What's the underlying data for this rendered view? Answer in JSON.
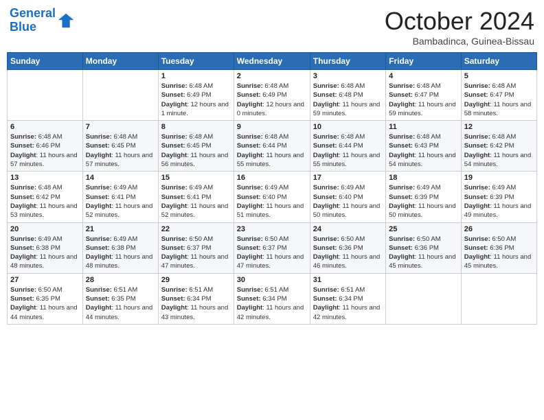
{
  "header": {
    "logo_line1": "General",
    "logo_line2": "Blue",
    "month_title": "October 2024",
    "location": "Bambadinca, Guinea-Bissau"
  },
  "days_of_week": [
    "Sunday",
    "Monday",
    "Tuesday",
    "Wednesday",
    "Thursday",
    "Friday",
    "Saturday"
  ],
  "weeks": [
    [
      {
        "day": "",
        "info": ""
      },
      {
        "day": "",
        "info": ""
      },
      {
        "day": "1",
        "info": "Sunrise: 6:48 AM\nSunset: 6:49 PM\nDaylight: 12 hours and 1 minute."
      },
      {
        "day": "2",
        "info": "Sunrise: 6:48 AM\nSunset: 6:49 PM\nDaylight: 12 hours and 0 minutes."
      },
      {
        "day": "3",
        "info": "Sunrise: 6:48 AM\nSunset: 6:48 PM\nDaylight: 11 hours and 59 minutes."
      },
      {
        "day": "4",
        "info": "Sunrise: 6:48 AM\nSunset: 6:47 PM\nDaylight: 11 hours and 59 minutes."
      },
      {
        "day": "5",
        "info": "Sunrise: 6:48 AM\nSunset: 6:47 PM\nDaylight: 11 hours and 58 minutes."
      }
    ],
    [
      {
        "day": "6",
        "info": "Sunrise: 6:48 AM\nSunset: 6:46 PM\nDaylight: 11 hours and 57 minutes."
      },
      {
        "day": "7",
        "info": "Sunrise: 6:48 AM\nSunset: 6:45 PM\nDaylight: 11 hours and 57 minutes."
      },
      {
        "day": "8",
        "info": "Sunrise: 6:48 AM\nSunset: 6:45 PM\nDaylight: 11 hours and 56 minutes."
      },
      {
        "day": "9",
        "info": "Sunrise: 6:48 AM\nSunset: 6:44 PM\nDaylight: 11 hours and 55 minutes."
      },
      {
        "day": "10",
        "info": "Sunrise: 6:48 AM\nSunset: 6:44 PM\nDaylight: 11 hours and 55 minutes."
      },
      {
        "day": "11",
        "info": "Sunrise: 6:48 AM\nSunset: 6:43 PM\nDaylight: 11 hours and 54 minutes."
      },
      {
        "day": "12",
        "info": "Sunrise: 6:48 AM\nSunset: 6:42 PM\nDaylight: 11 hours and 54 minutes."
      }
    ],
    [
      {
        "day": "13",
        "info": "Sunrise: 6:48 AM\nSunset: 6:42 PM\nDaylight: 11 hours and 53 minutes."
      },
      {
        "day": "14",
        "info": "Sunrise: 6:49 AM\nSunset: 6:41 PM\nDaylight: 11 hours and 52 minutes."
      },
      {
        "day": "15",
        "info": "Sunrise: 6:49 AM\nSunset: 6:41 PM\nDaylight: 11 hours and 52 minutes."
      },
      {
        "day": "16",
        "info": "Sunrise: 6:49 AM\nSunset: 6:40 PM\nDaylight: 11 hours and 51 minutes."
      },
      {
        "day": "17",
        "info": "Sunrise: 6:49 AM\nSunset: 6:40 PM\nDaylight: 11 hours and 50 minutes."
      },
      {
        "day": "18",
        "info": "Sunrise: 6:49 AM\nSunset: 6:39 PM\nDaylight: 11 hours and 50 minutes."
      },
      {
        "day": "19",
        "info": "Sunrise: 6:49 AM\nSunset: 6:39 PM\nDaylight: 11 hours and 49 minutes."
      }
    ],
    [
      {
        "day": "20",
        "info": "Sunrise: 6:49 AM\nSunset: 6:38 PM\nDaylight: 11 hours and 48 minutes."
      },
      {
        "day": "21",
        "info": "Sunrise: 6:49 AM\nSunset: 6:38 PM\nDaylight: 11 hours and 48 minutes."
      },
      {
        "day": "22",
        "info": "Sunrise: 6:50 AM\nSunset: 6:37 PM\nDaylight: 11 hours and 47 minutes."
      },
      {
        "day": "23",
        "info": "Sunrise: 6:50 AM\nSunset: 6:37 PM\nDaylight: 11 hours and 47 minutes."
      },
      {
        "day": "24",
        "info": "Sunrise: 6:50 AM\nSunset: 6:36 PM\nDaylight: 11 hours and 46 minutes."
      },
      {
        "day": "25",
        "info": "Sunrise: 6:50 AM\nSunset: 6:36 PM\nDaylight: 11 hours and 45 minutes."
      },
      {
        "day": "26",
        "info": "Sunrise: 6:50 AM\nSunset: 6:36 PM\nDaylight: 11 hours and 45 minutes."
      }
    ],
    [
      {
        "day": "27",
        "info": "Sunrise: 6:50 AM\nSunset: 6:35 PM\nDaylight: 11 hours and 44 minutes."
      },
      {
        "day": "28",
        "info": "Sunrise: 6:51 AM\nSunset: 6:35 PM\nDaylight: 11 hours and 44 minutes."
      },
      {
        "day": "29",
        "info": "Sunrise: 6:51 AM\nSunset: 6:34 PM\nDaylight: 11 hours and 43 minutes."
      },
      {
        "day": "30",
        "info": "Sunrise: 6:51 AM\nSunset: 6:34 PM\nDaylight: 11 hours and 42 minutes."
      },
      {
        "day": "31",
        "info": "Sunrise: 6:51 AM\nSunset: 6:34 PM\nDaylight: 11 hours and 42 minutes."
      },
      {
        "day": "",
        "info": ""
      },
      {
        "day": "",
        "info": ""
      }
    ]
  ]
}
